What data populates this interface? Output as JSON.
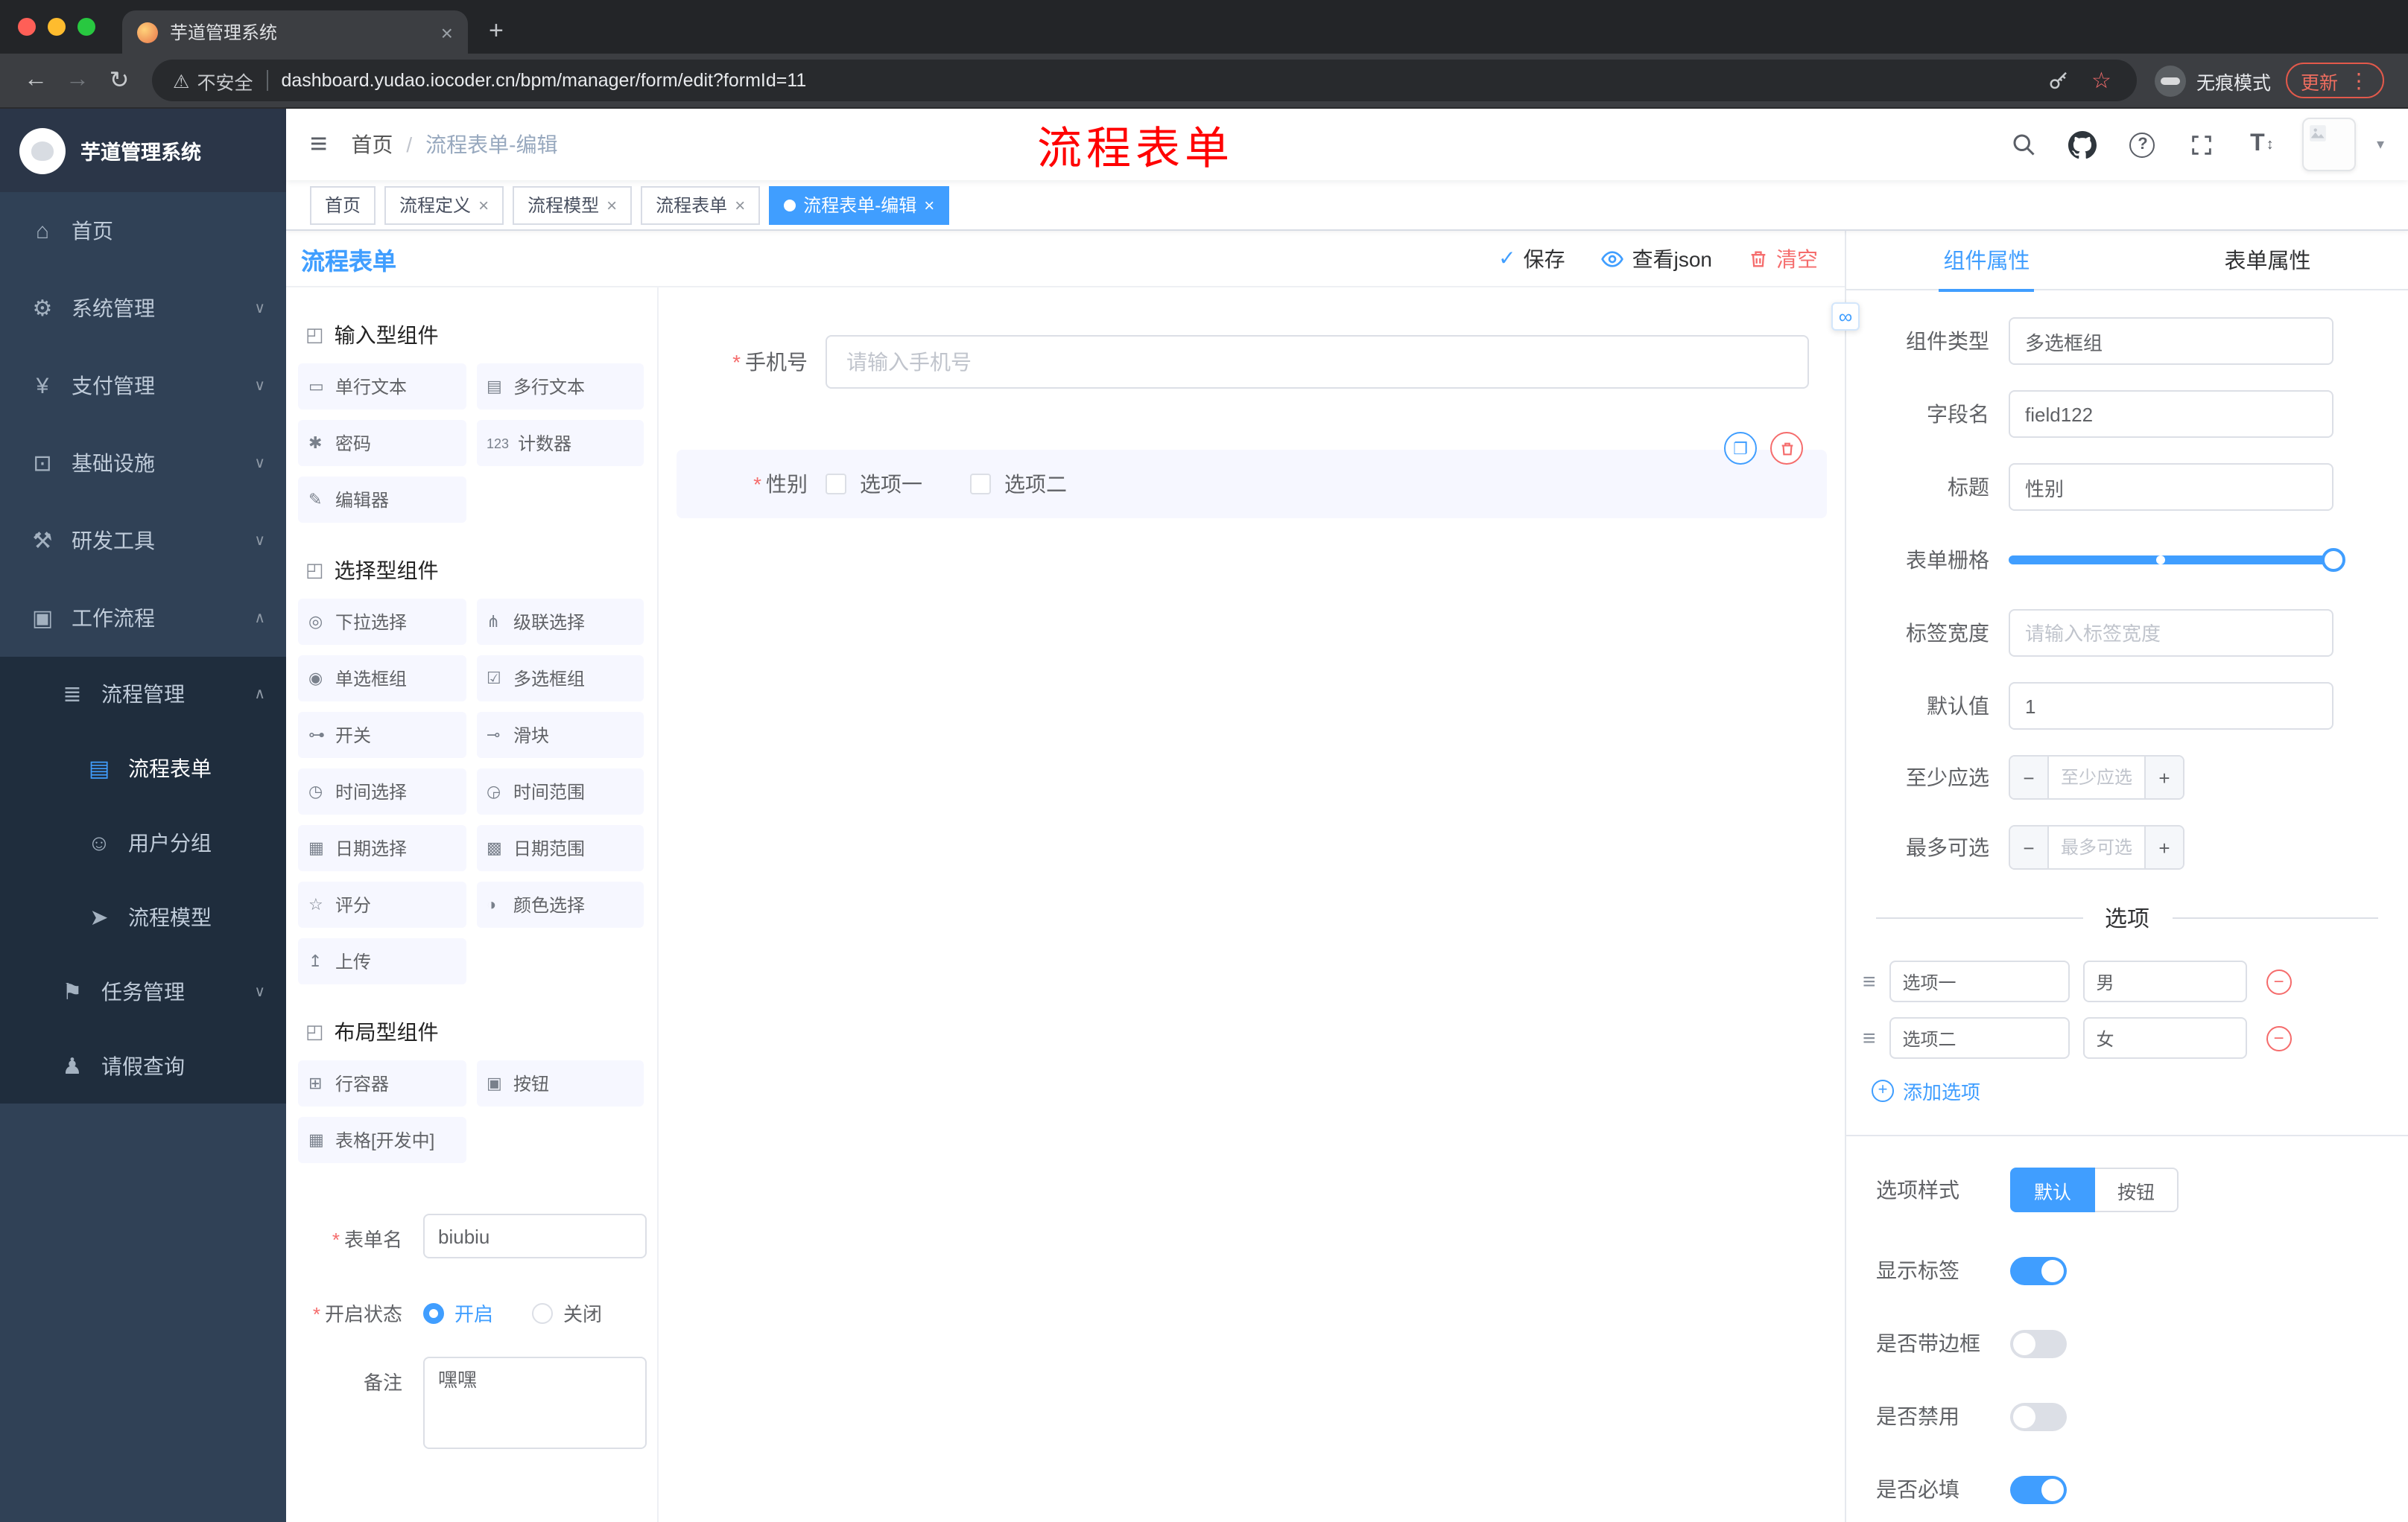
{
  "browser": {
    "tab_title": "芋道管理系统",
    "address": {
      "security_label": "不安全",
      "url": "dashboard.yudao.iocoder.cn/bpm/manager/form/edit?formId=11"
    },
    "incognito_label": "无痕模式",
    "update_label": "更新"
  },
  "icons": {
    "close": "×",
    "back": "←",
    "forward": "→",
    "reload": "↻",
    "warning": "⚠",
    "star": "☆",
    "kebab": "⋮",
    "hamburger": "≡",
    "new_tab": "+",
    "check": "✓",
    "copy": "❐",
    "question": "?",
    "text_size": "T",
    "up_down": "↕",
    "caret_down": "▾",
    "link": "∞",
    "drag": "≡",
    "remove": "−",
    "minus": "−",
    "plus": "+",
    "crumb_sep": "/"
  },
  "sidebar": {
    "title": "芋道管理系统",
    "menu": [
      {
        "label": "首页",
        "icon": "⌂"
      },
      {
        "label": "系统管理",
        "icon": "⚙",
        "chevron": "∨"
      },
      {
        "label": "支付管理",
        "icon": "¥",
        "chevron": "∨"
      },
      {
        "label": "基础设施",
        "icon": "⊡",
        "chevron": "∨"
      },
      {
        "label": "研发工具",
        "icon": "⚒",
        "chevron": "∨"
      },
      {
        "label": "工作流程",
        "icon": "▣",
        "chevron": "∧"
      },
      {
        "label": "流程管理",
        "icon": "≣",
        "chevron": "∧"
      },
      {
        "label": "流程表单",
        "icon": "▤"
      },
      {
        "label": "用户分组",
        "icon": "☺"
      },
      {
        "label": "流程模型",
        "icon": "➤"
      },
      {
        "label": "任务管理",
        "icon": "⚑",
        "chevron": "∨"
      },
      {
        "label": "请假查询",
        "icon": "♟"
      }
    ]
  },
  "navbar": {
    "breadcrumb": {
      "home": "首页",
      "current": "流程表单-编辑"
    },
    "overlay_title": "流程表单"
  },
  "tags": [
    {
      "label": "首页"
    },
    {
      "label": "流程定义"
    },
    {
      "label": "流程模型"
    },
    {
      "label": "流程表单"
    },
    {
      "label": "流程表单-编辑"
    }
  ],
  "designer": {
    "title": "流程表单",
    "actions": {
      "save": "保存",
      "view_json": "查看json",
      "clear": "清空"
    },
    "palette": {
      "groups": [
        {
          "title": "输入型组件",
          "items": [
            {
              "label": "单行文本",
              "icon": "▭"
            },
            {
              "label": "多行文本",
              "icon": "▤"
            },
            {
              "label": "密码",
              "icon": "✱"
            },
            {
              "label": "计数器",
              "icon": "123"
            },
            {
              "label": "编辑器",
              "icon": "✎"
            }
          ]
        },
        {
          "title": "选择型组件",
          "items": [
            {
              "label": "下拉选择",
              "icon": "◎"
            },
            {
              "label": "级联选择",
              "icon": "⋔"
            },
            {
              "label": "单选框组",
              "icon": "◉"
            },
            {
              "label": "多选框组",
              "icon": "☑"
            },
            {
              "label": "开关",
              "icon": "⊶"
            },
            {
              "label": "滑块",
              "icon": "⊸"
            },
            {
              "label": "时间选择",
              "icon": "◷"
            },
            {
              "label": "时间范围",
              "icon": "◶"
            },
            {
              "label": "日期选择",
              "icon": "▦"
            },
            {
              "label": "日期范围",
              "icon": "▩"
            },
            {
              "label": "评分",
              "icon": "☆"
            },
            {
              "label": "颜色选择",
              "icon": "◑"
            },
            {
              "label": "上传",
              "icon": "↥"
            }
          ]
        },
        {
          "title": "布局型组件",
          "items": [
            {
              "label": "行容器",
              "icon": "⊞"
            },
            {
              "label": "按钮",
              "icon": "▣"
            },
            {
              "label": "表格[开发中]",
              "icon": "▦"
            }
          ]
        }
      ]
    },
    "meta": {
      "form_name": {
        "label": "表单名",
        "value": "biubiu"
      },
      "status": {
        "label": "开启状态",
        "on": "开启",
        "off": "关闭"
      },
      "remark": {
        "label": "备注",
        "value": "嘿嘿"
      }
    },
    "canvas": {
      "phone": {
        "label": "手机号",
        "placeholder": "请输入手机号"
      },
      "gender": {
        "label": "性别",
        "option1": "选项一",
        "option2": "选项二"
      }
    }
  },
  "props": {
    "tabs": {
      "component": "组件属性",
      "form": "表单属性"
    },
    "rows": {
      "component_type": {
        "label": "组件类型",
        "value": "多选框组"
      },
      "field_name": {
        "label": "字段名",
        "value": "field122"
      },
      "title": {
        "label": "标题",
        "value": "性别"
      },
      "grid": {
        "label": "表单栅格"
      },
      "label_width": {
        "label": "标签宽度",
        "placeholder": "请输入标签宽度"
      },
      "default": {
        "label": "默认值",
        "value": "1"
      },
      "min": {
        "label": "至少应选",
        "placeholder": "至少应选"
      },
      "max": {
        "label": "最多可选",
        "placeholder": "最多可选"
      }
    },
    "options": {
      "divider": "选项",
      "rows": [
        {
          "label": "选项一",
          "value": "男"
        },
        {
          "label": "选项二",
          "value": "女"
        }
      ],
      "add": "添加选项"
    },
    "style": {
      "label": "选项样式",
      "choice_default": "默认",
      "choice_button": "按钮"
    },
    "switches": [
      {
        "label": "显示标签"
      },
      {
        "label": "是否带边框"
      },
      {
        "label": "是否禁用"
      },
      {
        "label": "是否必填"
      }
    ]
  }
}
